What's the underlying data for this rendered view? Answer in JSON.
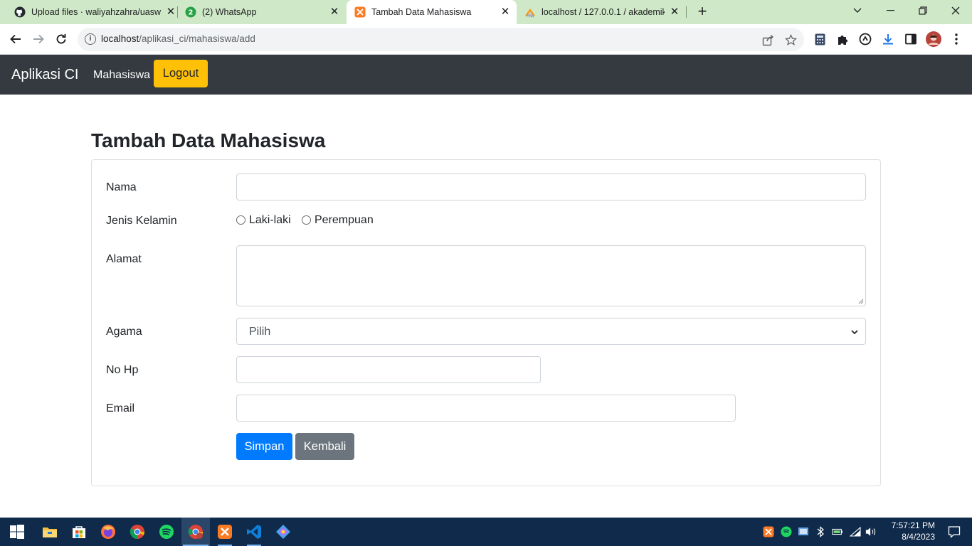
{
  "browser": {
    "tabs": [
      {
        "title": "Upload files · waliyahzahra/uasweb",
        "icon": "github-icon"
      },
      {
        "title": "(2) WhatsApp",
        "icon": "whatsapp-icon"
      },
      {
        "title": "Tambah Data Mahasiswa",
        "icon": "xampp-icon"
      },
      {
        "title": "localhost / 127.0.0.1 / akademik | phpMyAdmin",
        "icon": "phpmyadmin-icon"
      }
    ],
    "url_host": "localhost",
    "url_path": "/aplikasi_ci/mahasiswa/add"
  },
  "navbar": {
    "brand": "Aplikasi CI",
    "link_mahasiswa": "Mahasiswa",
    "logout_label": "Logout"
  },
  "page": {
    "title": "Tambah Data Mahasiswa"
  },
  "form": {
    "nama_label": "Nama",
    "nama_value": "",
    "jk_label": "Jenis Kelamin",
    "jk_options": [
      "Laki-laki",
      "Perempuan"
    ],
    "alamat_label": "Alamat",
    "alamat_value": "",
    "agama_label": "Agama",
    "agama_selected": "Pilih",
    "nohp_label": "No Hp",
    "nohp_value": "",
    "email_label": "Email",
    "email_value": "",
    "submit_label": "Simpan",
    "back_label": "Kembali"
  },
  "taskbar": {
    "time": "7:57:21 PM",
    "date": "8/4/2023"
  },
  "colors": {
    "navbar_bg": "#343a40",
    "logout_bg": "#ffc107",
    "primary": "#007bff",
    "secondary": "#6c757d",
    "tabstrip_bg": "#cfe8c7"
  }
}
